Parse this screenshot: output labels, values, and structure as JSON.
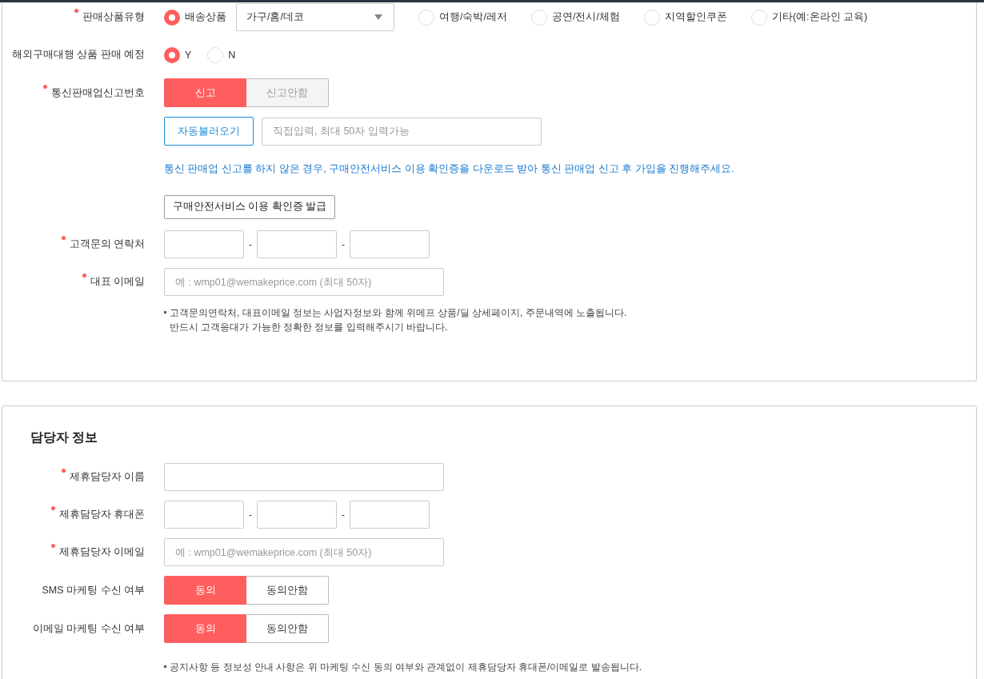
{
  "sections": [
    {
      "rows": [
        {
          "kind": "radio",
          "label": "판매상품유형",
          "required": true,
          "options": [
            {
              "label": "배송상품",
              "selected": true,
              "dropdown": "가구/홈/데코"
            },
            {
              "label": "여행/숙박/레저",
              "selected": false
            },
            {
              "label": "공연/전시/체험",
              "selected": false
            },
            {
              "label": "지역할인쿠폰",
              "selected": false
            },
            {
              "label": "기타(예:온라인 교육)",
              "selected": false
            }
          ]
        },
        {
          "kind": "radio",
          "label": "해외구매대행 상품 판매 예정",
          "required": false,
          "options": [
            {
              "label": "Y",
              "selected": true
            },
            {
              "label": "N",
              "selected": false
            }
          ]
        },
        {
          "kind": "toggle",
          "label": "통신판매업신고번호",
          "required": true,
          "options": [
            {
              "label": "신고",
              "selected": true,
              "disabled": false
            },
            {
              "label": "신고안함",
              "selected": false,
              "disabled": true
            }
          ]
        },
        {
          "kind": "lookup",
          "button": "자동불러오기",
          "placeholder": "직접입력, 최대 50자 입력가능"
        },
        {
          "kind": "notice",
          "text": "통신 판매업 신고를 하지 않은 경우, 구매안전서비스 이용 확인증을 다운로드 받아 통신 판매업 신고 후 가입을 진행해주세요."
        },
        {
          "kind": "action",
          "button": "구매안전서비스 이용 확인증 발급"
        },
        {
          "kind": "phone",
          "label": "고객문의 연락처",
          "required": true,
          "separators": [
            "-",
            "-"
          ]
        },
        {
          "kind": "input",
          "label": "대표 이메일",
          "required": true,
          "placeholder": "예 : wmp01@wemakeprice.com (최대 50자)"
        },
        {
          "kind": "note",
          "lines": [
            "고객문의연락처, 대표이메일 정보는 사업자정보와 함께 위메프 상품/딜 상세페이지, 주문내역에 노출됩니다.",
            "반드시 고객응대가 가능한 정확한 정보를 입력해주시기 바랍니다."
          ]
        }
      ]
    },
    {
      "title": "담당자 정보",
      "rows": [
        {
          "kind": "input",
          "label": "제휴담당자 이름",
          "required": true
        },
        {
          "kind": "phone",
          "label": "제휴담당자 휴대폰",
          "required": true,
          "separators": [
            "-",
            "-"
          ]
        },
        {
          "kind": "input",
          "label": "제휴담당자 이메일",
          "required": true,
          "placeholder": "예 : wmp01@wemakeprice.com (최대 50자)"
        },
        {
          "kind": "toggle",
          "label": "SMS 마케팅 수신 여부",
          "required": false,
          "options": [
            {
              "label": "동의",
              "selected": true,
              "disabled": false
            },
            {
              "label": "동의안함",
              "selected": false,
              "disabled": false
            }
          ]
        },
        {
          "kind": "toggle",
          "label": "이메일 마케팅 수신 여부",
          "required": false,
          "options": [
            {
              "label": "동의",
              "selected": true,
              "disabled": false
            },
            {
              "label": "동의안함",
              "selected": false,
              "disabled": false
            }
          ]
        },
        {
          "kind": "note",
          "lines": [
            "공지사항 등 정보성 안내 사항은 위 마케팅 수신 동의 여부와 관계없이 제휴담당자 휴대폰/이메일로 발송됩니다."
          ]
        }
      ]
    }
  ]
}
